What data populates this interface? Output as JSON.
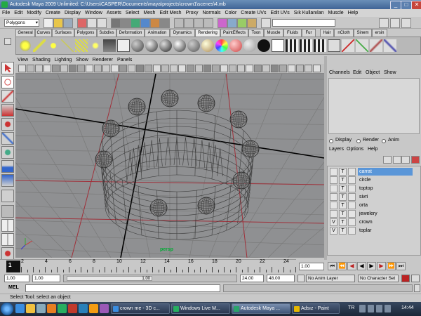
{
  "window": {
    "title": "Autodesk Maya 2009 Unlimited: C:\\Users\\CASPER\\Documents\\maya\\projects\\crown1\\scenes\\4.mb",
    "minimize": "_",
    "maximize": "□",
    "close": "✕"
  },
  "menu": [
    "File",
    "Edit",
    "Modify",
    "Create",
    "Display",
    "Window",
    "Assets",
    "Select",
    "Mesh",
    "Edit Mesh",
    "Proxy",
    "Normals",
    "Color",
    "Create UVs",
    "Edit UVs",
    "Sık Kullanılan",
    "Muscle",
    "Help"
  ],
  "mode_select": "Polygons",
  "shelf_tabs": [
    "General",
    "Curves",
    "Surfaces",
    "Polygons",
    "Subdivs",
    "Deformation",
    "Animation",
    "Dynamics",
    "Rendering",
    "PaintEffects",
    "Toon",
    "Muscle",
    "Fluids",
    "Fur",
    "Hair",
    "nCloth",
    "Sinem",
    "ersin"
  ],
  "active_shelf_tab": "Rendering",
  "panel_menu": [
    "View",
    "Shading",
    "Lighting",
    "Show",
    "Renderer",
    "Panels"
  ],
  "camera_label": "persp",
  "channel_box_menu": [
    "Channels",
    "Edit",
    "Object",
    "Show"
  ],
  "layer_mode": {
    "display": "Display",
    "render": "Render",
    "anim": "Anim"
  },
  "layer_menu": [
    "Layers",
    "Options",
    "Help"
  ],
  "layers": [
    {
      "name": "carrat",
      "visible": "",
      "template": "T",
      "selected": true
    },
    {
      "name": "circle",
      "visible": "",
      "template": "T",
      "selected": false
    },
    {
      "name": "toptop",
      "visible": "",
      "template": "T",
      "selected": false
    },
    {
      "name": "sivri",
      "visible": "",
      "template": "T",
      "selected": false
    },
    {
      "name": "orta",
      "visible": "",
      "template": "T",
      "selected": false
    },
    {
      "name": "jewelery",
      "visible": "",
      "template": "T",
      "selected": false
    },
    {
      "name": "crown",
      "visible": "V",
      "template": "T",
      "selected": false
    },
    {
      "name": "toplar",
      "visible": "V",
      "template": "T",
      "selected": false
    }
  ],
  "timeline": {
    "ticks": [
      "1",
      "2",
      "4",
      "6",
      "8",
      "10",
      "12",
      "14",
      "16",
      "18",
      "20",
      "22",
      "24"
    ],
    "current_frame": "1.00"
  },
  "range": {
    "start": "1.00",
    "playback_start": "1.00",
    "range_label": "1.00",
    "playback_end": "24.00",
    "end": "48.00"
  },
  "anim_layer": "No Anim Layer",
  "character_set": "No Character Set",
  "command_label": "MEL",
  "help_line": "Select Tool: select an object",
  "taskbar": {
    "items": [
      "crown me - 3D c...",
      "Windows Live M...",
      "Autodesk Maya ...",
      "Adsız - Paint"
    ],
    "lang": "TR",
    "clock": "14:44"
  },
  "colors": {
    "accent": "#5a7ec4",
    "selected_layer": "#4a86d8",
    "viewport": "#8f9092",
    "grid": "#7a7a7a",
    "grid_axis": "#000000",
    "grid_red": "#a0303a"
  }
}
